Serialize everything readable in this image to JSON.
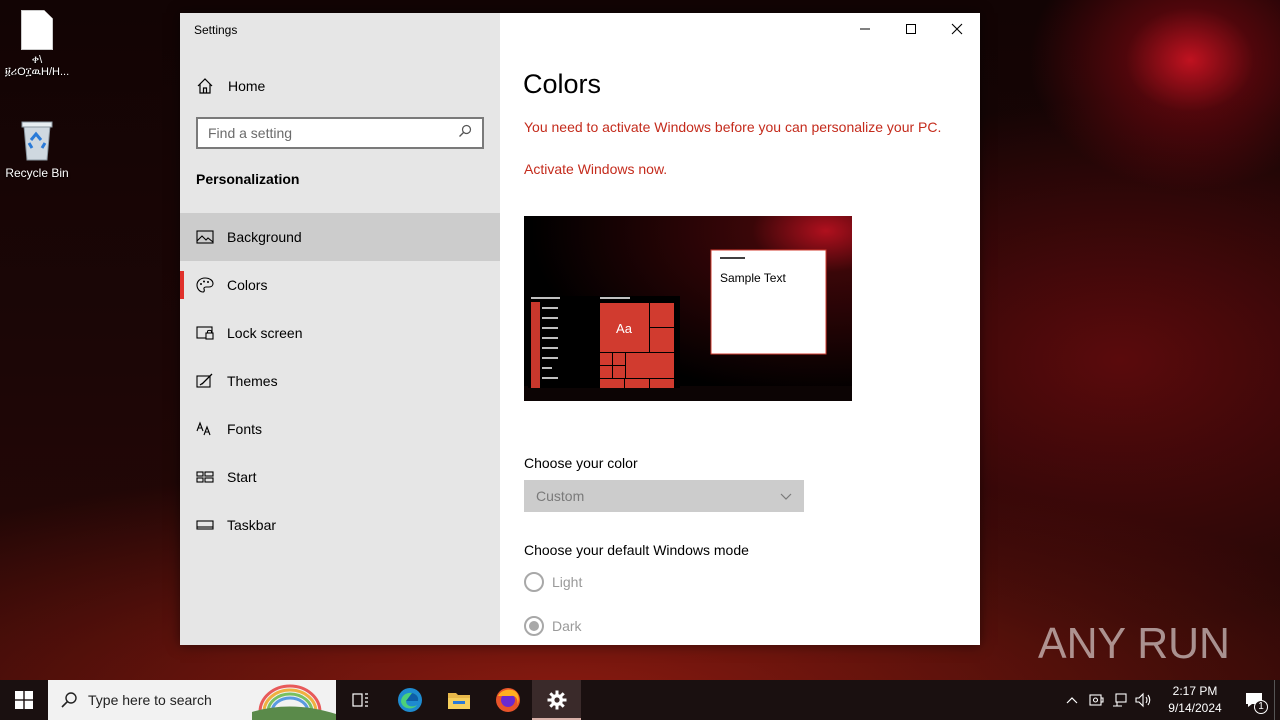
{
  "desktop": {
    "icons": [
      {
        "label": "ቀ\\\n፱ሪΟ፲ዉΗ/Η..."
      },
      {
        "label": "Recycle Bin"
      }
    ]
  },
  "window": {
    "title": "Settings",
    "sidebar": {
      "home_label": "Home",
      "search_placeholder": "Find a setting",
      "section_title": "Personalization",
      "items": [
        {
          "label": "Background",
          "icon": "picture-icon"
        },
        {
          "label": "Colors",
          "icon": "palette-icon"
        },
        {
          "label": "Lock screen",
          "icon": "lock-screen-icon"
        },
        {
          "label": "Themes",
          "icon": "themes-icon"
        },
        {
          "label": "Fonts",
          "icon": "fonts-icon"
        },
        {
          "label": "Start",
          "icon": "start-icon"
        },
        {
          "label": "Taskbar",
          "icon": "taskbar-icon"
        }
      ]
    },
    "content": {
      "title": "Colors",
      "warning": "You need to activate Windows before you can personalize your PC.",
      "activate_link": "Activate Windows now.",
      "preview": {
        "tile_label": "Aa",
        "sample_text": "Sample Text"
      },
      "choose_color_label": "Choose your color",
      "color_dropdown_value": "Custom",
      "choose_mode_label": "Choose your default Windows mode",
      "modes": [
        {
          "label": "Light",
          "selected": false
        },
        {
          "label": "Dark",
          "selected": true
        }
      ]
    }
  },
  "taskbar": {
    "search_placeholder": "Type here to search",
    "time": "2:17 PM",
    "date": "9/14/2024",
    "notification_count": "1"
  },
  "watermark": "ANY RUN",
  "colors": {
    "accent": "#e0312b",
    "warning": "#c42b1c",
    "tile": "#d13b2f"
  }
}
